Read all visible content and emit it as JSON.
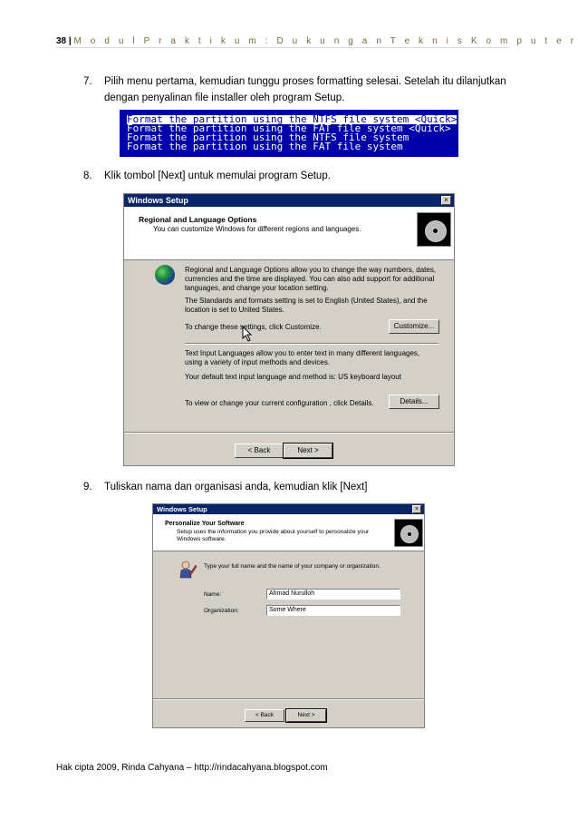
{
  "header": {
    "page_number": "38",
    "separator": "|",
    "module_title": "M o d u l  P r a k t i k u m :  D u k u n g a n  T e k n i s  K o m p u t e r"
  },
  "steps": [
    {
      "number": "7.",
      "lines": [
        "Pilih menu pertama, kemudian tunggu proses formatting selesai. Setelah itu dilanjutkan",
        "dengan penyalinan file installer oleh program Setup."
      ]
    },
    {
      "number": "8.",
      "lines": [
        "Klik tombol [Next] untuk memulai program Setup."
      ]
    },
    {
      "number": "9.",
      "lines": [
        "Tuliskan nama dan organisasi anda, kemudian klik [Next]"
      ]
    }
  ],
  "format_menu": {
    "options": [
      "Format the partition using the NTFS file system <Quick>",
      "Format the partition using the FAT file system <Quick>",
      "Format the partition using the NTFS file system",
      "Format the partition using the FAT file system"
    ]
  },
  "dialog_regional": {
    "title": "Windows Setup",
    "close": "×",
    "heading": "Regional and Language Options",
    "subheading": "You can customize Windows for different regions and languages.",
    "p1": "Regional and Language Options allow you to change the way numbers, dates, currencies and the time are displayed. You can also add support for additional languages, and change your location setting.",
    "p2": "The Standards and formats setting is set to English (United States), and the location is set to United States.",
    "p3": "To change these settings, click Customize.",
    "customize_button": "Customize...",
    "p4": "Text Input Languages allow you to enter text in many different languages, using a variety of input methods and devices.",
    "p5": "Your default text input language and method is: US keyboard layout",
    "p6": "To view or change your current configuration , click Details.",
    "details_button": "Details...",
    "back_button": "< Back",
    "next_button": "Next >"
  },
  "dialog_personalize": {
    "title": "Windows Setup",
    "close": "×",
    "heading": "Personalize Your Software",
    "subheading": "Setup uses the information you provide about yourself to personalize your Windows software.",
    "instruction": "Type your full name and the name of your company or organization.",
    "name_label": "Name:",
    "name_value": "Ahmad Nurulloh",
    "org_label": "Organization:",
    "org_value": "Some Where",
    "back_button": "< Back",
    "next_button": "Next >"
  },
  "footer": {
    "text": "Hak cipta 2009, Rinda Cahyana – http://rindacahyana.blogspot.com"
  }
}
